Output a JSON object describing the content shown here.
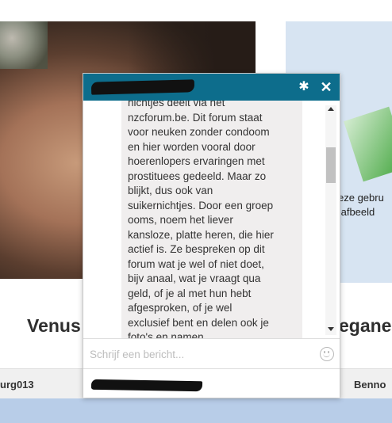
{
  "background": {
    "right_photo_caption": "eze gebru\n afbeeld",
    "profile_name_left": "Venus",
    "profile_name_right": "egane",
    "username_left": "urg013",
    "username_right": "Benno"
  },
  "chat": {
    "title": "",
    "settings_icon": "gear-icon",
    "close_label": "✕",
    "message_lines": [
      "nichtjes deelt via het",
      "nzcforum.be. Dit forum staat",
      "voor neuken zonder condoom",
      "en hier worden vooral door",
      "hoerenlopers ervaringen met",
      "prostituees gedeeld. Maar zo",
      "blijkt, dus ook van",
      "suikernichtjes. Door een groep",
      "ooms, noem het liever",
      "kansloze, platte heren, die hier",
      "actief is. Ze bespreken op dit",
      "forum wat je wel of niet doet,",
      "bijv anaal, wat je vraagt qua",
      "geld, of je al met hun hebt",
      "afgesproken, of je wel",
      "exclusief bent en delen ook je",
      "foto's en namen"
    ],
    "compose_placeholder": "Schrijf een bericht...",
    "compose_value": "",
    "emoji_icon": "smiley-icon"
  },
  "colors": {
    "header": "#0d6d8c",
    "bubble": "#f0eeee",
    "bottom_band": "#b8cde8"
  }
}
